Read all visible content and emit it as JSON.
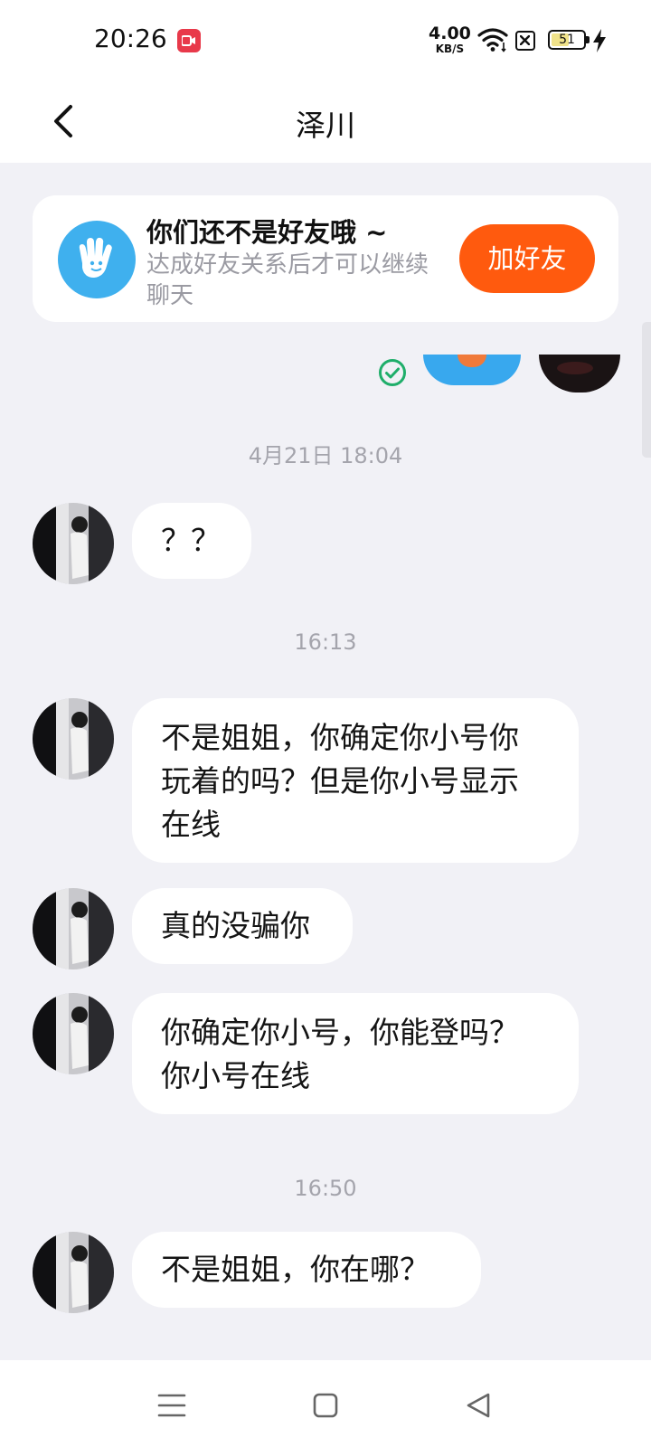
{
  "status_bar": {
    "time": "20:26",
    "net_speed_value": "4.00",
    "net_speed_unit": "KB/S",
    "battery_level": "51",
    "icons": [
      "screen-record-icon",
      "wifi-icon",
      "sim-blocked-icon",
      "battery-icon",
      "charging-bolt-icon"
    ]
  },
  "header": {
    "title": "泽川",
    "back_icon": "chevron-left-icon"
  },
  "friend_card": {
    "title": "你们还不是好友哦 ~",
    "subtitle": "达成好友关系后才可以继续聊天",
    "button_label": "加好友",
    "button_color": "#ff5a0e",
    "avatar_icon": "waving-hand-icon"
  },
  "messages": [
    {
      "type": "time",
      "text": "4月21日 18:04"
    },
    {
      "type": "message",
      "text": "？？"
    },
    {
      "type": "time",
      "text": "16:13"
    },
    {
      "type": "message",
      "line1": "不是姐姐，你确定你小号你",
      "line2": "玩着的吗？但是你小号显示",
      "line3": "在线"
    },
    {
      "type": "message",
      "text": "真的没骗你"
    },
    {
      "type": "message",
      "line1": "你确定你小号，你能登吗？",
      "line2": "你小号在线"
    },
    {
      "type": "time",
      "text": "16:50"
    },
    {
      "type": "message",
      "text": "不是姐姐，你在哪？"
    }
  ],
  "nav_bar": {
    "icons": [
      "menu-icon",
      "home-square-icon",
      "back-triangle-icon"
    ]
  },
  "colors": {
    "background": "#f1f1f6",
    "bubble": "#ffffff",
    "accent": "#ff5a0e",
    "timestamp": "#a4a4ac"
  }
}
